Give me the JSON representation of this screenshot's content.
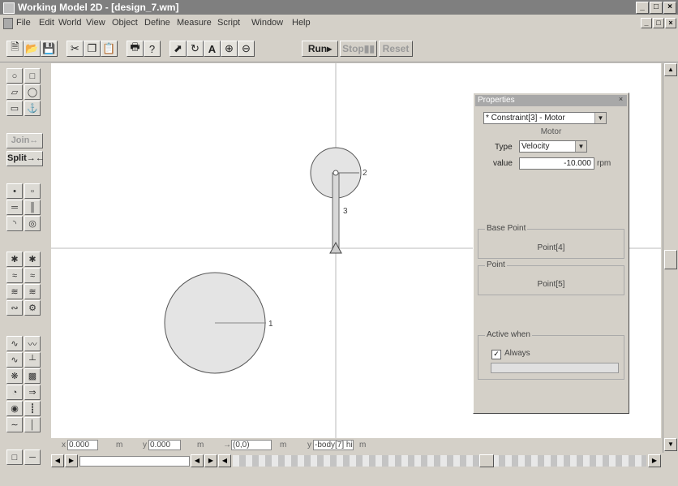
{
  "window": {
    "title": "Working Model 2D - [design_7.wm]",
    "controls": [
      "_",
      "□",
      "×"
    ]
  },
  "menu": {
    "items": [
      "File",
      "Edit",
      "World",
      "View",
      "Object",
      "Define",
      "Measure",
      "Script",
      "Window",
      "Help"
    ]
  },
  "toolbar": {
    "run_label": "Run▸",
    "stop_label": "Stop▮▮",
    "reset_label": "Reset"
  },
  "palette": {
    "join_label": "Join↔",
    "split_label": "Split→←"
  },
  "canvas": {
    "body1_label": "1",
    "body2_label": "2",
    "constraint3_label": "3"
  },
  "properties": {
    "title": "Properties",
    "object_select": "* Constraint[3] - Motor",
    "section_label": "Motor",
    "type_label": "Type",
    "type_value": "Velocity",
    "value_label": "value",
    "value_value": "-10.000",
    "value_unit": "rpm",
    "base_point_label": "Base Point",
    "base_point_value": "Point[4]",
    "point_label": "Point",
    "point_value": "Point[5]",
    "active_when_label": "Active when",
    "always_label": "Always",
    "always_checked": true
  },
  "status": {
    "x_label": "x",
    "x_value": "0.000",
    "x_unit": "m",
    "y_label": "y",
    "y_value": "0.000",
    "y_unit": "m",
    "rot_label": "→",
    "rot_value": "(0,0)",
    "rot_unit": "m",
    "body_label": "y",
    "body_value": "-body[7] hi",
    "body_unit": "m"
  }
}
